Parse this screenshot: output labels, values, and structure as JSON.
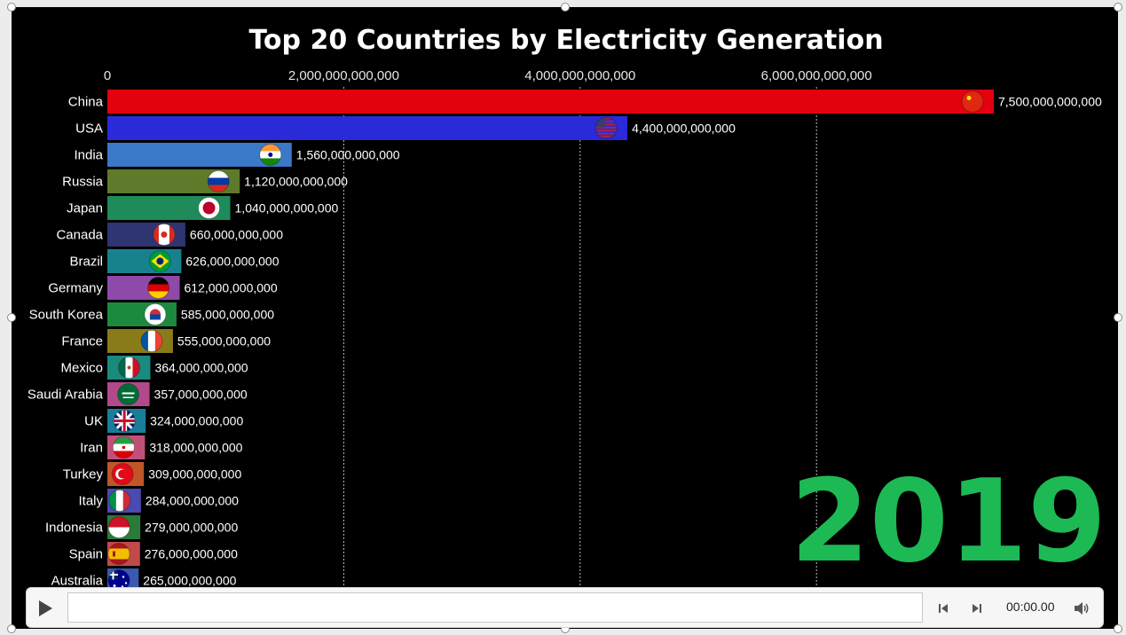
{
  "chart_data": {
    "type": "bar",
    "orientation": "horizontal",
    "title": "Top 20 Countries by Electricity Generation",
    "xlim": [
      0,
      7500000000000
    ],
    "x_ticks": [
      0,
      2000000000000,
      4000000000000,
      6000000000000
    ],
    "x_tick_labels": [
      "0",
      "2,000,000,000,000",
      "4,000,000,000,000",
      "6,000,000,000,000"
    ],
    "grid": "vertical dashed",
    "year_label": "2019",
    "year_color": "#1db954",
    "bars": [
      {
        "country": "China",
        "value": 7500000000000,
        "label": "7,500,000,000,000",
        "color": "#e3000f",
        "flag": "china-flag"
      },
      {
        "country": "USA",
        "value": 4400000000000,
        "label": "4,400,000,000,000",
        "color": "#2a2ad9",
        "flag": "usa-flag"
      },
      {
        "country": "India",
        "value": 1560000000000,
        "label": "1,560,000,000,000",
        "color": "#3a78c8",
        "flag": "india-flag"
      },
      {
        "country": "Russia",
        "value": 1120000000000,
        "label": "1,120,000,000,000",
        "color": "#5e7a2a",
        "flag": "russia-flag"
      },
      {
        "country": "Japan",
        "value": 1040000000000,
        "label": "1,040,000,000,000",
        "color": "#1f8a5a",
        "flag": "japan-flag"
      },
      {
        "country": "Canada",
        "value": 660000000000,
        "label": "660,000,000,000",
        "color": "#2e3570",
        "flag": "canada-flag"
      },
      {
        "country": "Brazil",
        "value": 626000000000,
        "label": "626,000,000,000",
        "color": "#17828e",
        "flag": "brazil-flag"
      },
      {
        "country": "Germany",
        "value": 612000000000,
        "label": "612,000,000,000",
        "color": "#8e4aa8",
        "flag": "germany-flag"
      },
      {
        "country": "South Korea",
        "value": 585000000000,
        "label": "585,000,000,000",
        "color": "#1c8a3e",
        "flag": "south-korea-flag"
      },
      {
        "country": "France",
        "value": 555000000000,
        "label": "555,000,000,000",
        "color": "#8a7b1a",
        "flag": "france-flag"
      },
      {
        "country": "Mexico",
        "value": 364000000000,
        "label": "364,000,000,000",
        "color": "#1a8a7e",
        "flag": "mexico-flag"
      },
      {
        "country": "Saudi Arabia",
        "value": 357000000000,
        "label": "357,000,000,000",
        "color": "#b04a8a",
        "flag": "saudi-arabia-flag"
      },
      {
        "country": "UK",
        "value": 324000000000,
        "label": "324,000,000,000",
        "color": "#1a7e9a",
        "flag": "uk-flag"
      },
      {
        "country": "Iran",
        "value": 318000000000,
        "label": "318,000,000,000",
        "color": "#c0507a",
        "flag": "iran-flag"
      },
      {
        "country": "Turkey",
        "value": 309000000000,
        "label": "309,000,000,000",
        "color": "#c0562a",
        "flag": "turkey-flag"
      },
      {
        "country": "Italy",
        "value": 284000000000,
        "label": "284,000,000,000",
        "color": "#4a4ab0",
        "flag": "italy-flag"
      },
      {
        "country": "Indonesia",
        "value": 279000000000,
        "label": "279,000,000,000",
        "color": "#2a7a3a",
        "flag": "indonesia-flag"
      },
      {
        "country": "Spain",
        "value": 276000000000,
        "label": "276,000,000,000",
        "color": "#c04a4a",
        "flag": "spain-flag"
      },
      {
        "country": "Australia",
        "value": 265000000000,
        "label": "265,000,000,000",
        "color": "#3a5ab0",
        "flag": "australia-flag"
      }
    ]
  },
  "player": {
    "time": "00:00.00",
    "play_icon": "play-icon",
    "back_icon": "step-back-icon",
    "forward_icon": "step-forward-icon",
    "volume_icon": "volume-icon"
  }
}
